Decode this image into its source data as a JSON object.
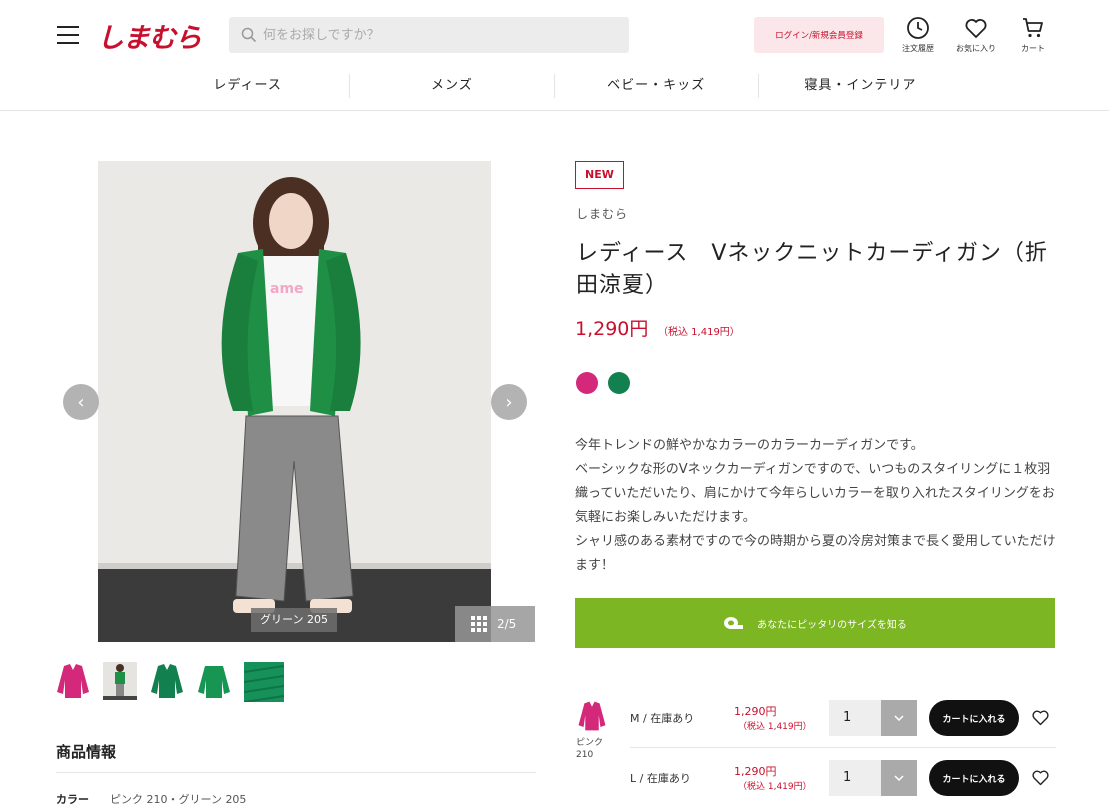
{
  "header": {
    "logo": "しまむら",
    "search_placeholder": "何をお探しですか？",
    "login_label": "ログイン/新規会員登録",
    "icons": [
      {
        "name": "order-history",
        "label": "注文履歴"
      },
      {
        "name": "favorites",
        "label": "お気に入り"
      },
      {
        "name": "cart",
        "label": "カート"
      }
    ],
    "nav": [
      "レディース",
      "メンズ",
      "ベビー・キッズ",
      "寝具・インテリア"
    ]
  },
  "gallery": {
    "color_tag": "グリーン 205",
    "counter": "2/5"
  },
  "product": {
    "badge": "NEW",
    "brand": "しまむら",
    "title": "レディース　Vネックニットカーディガン（折田涼夏）",
    "price": "1,290円",
    "price_tax": "（税込 1,419円）",
    "swatches": [
      {
        "name": "ピンク",
        "color": "#d4287a"
      },
      {
        "name": "グリーン",
        "color": "#13804f"
      }
    ],
    "description": [
      "今年トレンドの鮮やかなカラーのカラーカーディガンです。",
      "ベーシックな形のVネックカーディガンですので、いつものスタイリングに１枚羽織っていただいたり、肩にかけて今年らしいカラーを取り入れたスタイリングをお気軽にお楽しみいただけます。",
      "シャリ感のある素材ですので今の時期から夏の冷房対策まで長く愛用していただけます！"
    ],
    "size_button": "あなたにピッタリのサイズを知る"
  },
  "stock": {
    "color_label": "ピンク 210",
    "rows": [
      {
        "size": "M / 在庫あり",
        "price": "1,290円",
        "tax": "（税込 1,419円）",
        "qty": "1",
        "cart_label": "カートに入れる"
      },
      {
        "size": "L / 在庫あり",
        "price": "1,290円",
        "tax": "（税込 1,419円）",
        "qty": "1",
        "cart_label": "カートに入れる"
      }
    ]
  },
  "info": {
    "heading": "商品情報",
    "color_label": "カラー",
    "color_value": "ピンク 210・グリーン 205"
  },
  "colors": {
    "brand_red": "#c8102e",
    "size_button_green": "#7cb622",
    "pink": "#d4287a",
    "green": "#13804f"
  }
}
